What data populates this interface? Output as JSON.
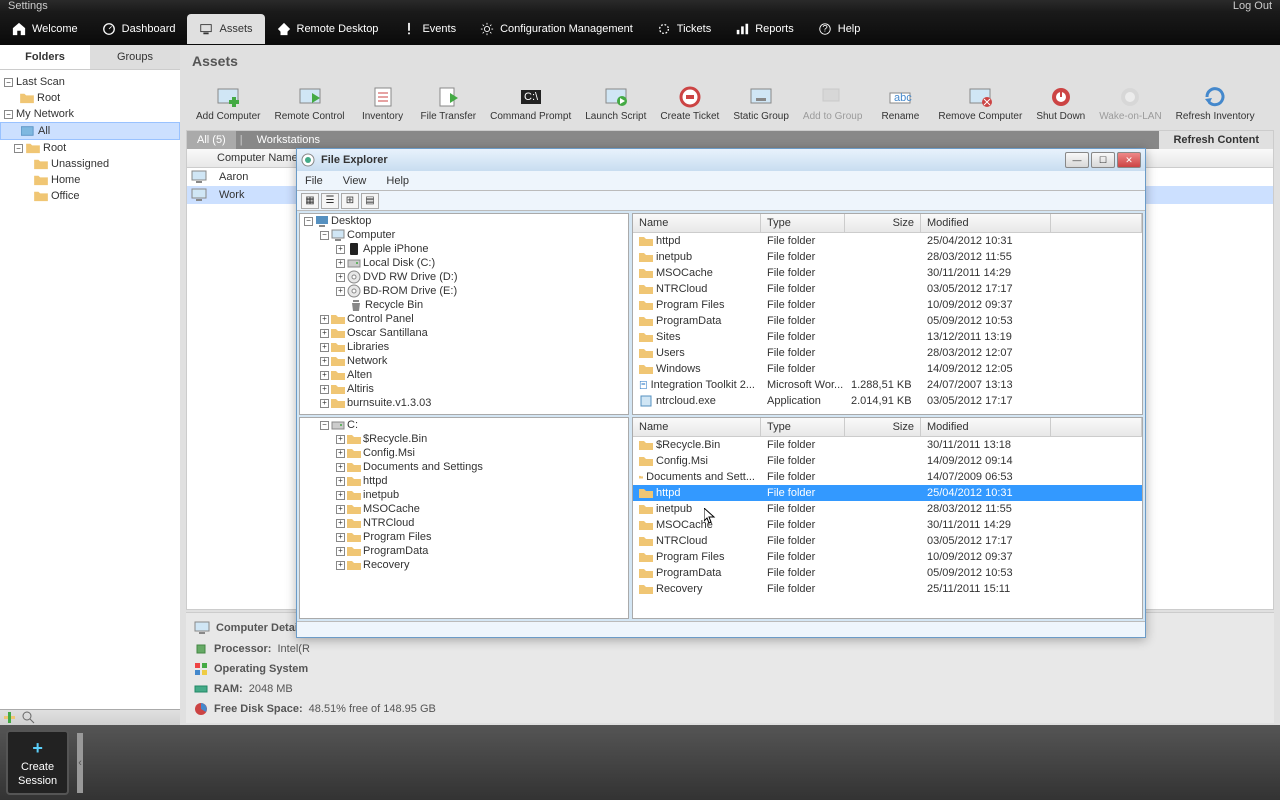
{
  "topbar": {
    "settings": "Settings",
    "logout": "Log Out"
  },
  "nav": {
    "welcome": "Welcome",
    "dashboard": "Dashboard",
    "assets": "Assets",
    "remote": "Remote Desktop",
    "events": "Events",
    "config": "Configuration Management",
    "tickets": "Tickets",
    "reports": "Reports",
    "help": "Help"
  },
  "sidebar": {
    "tabs": {
      "folders": "Folders",
      "groups": "Groups"
    },
    "lastscan": "Last Scan",
    "root": "Root",
    "mynetwork": "My Network",
    "all": "All",
    "root2": "Root",
    "unassigned": "Unassigned",
    "home": "Home",
    "office": "Office"
  },
  "main": {
    "title": "Assets",
    "tools": {
      "addcomputer": "Add Computer",
      "remotecontrol": "Remote Control",
      "inventory": "Inventory",
      "filetransfer": "File Transfer",
      "cmdprompt": "Command Prompt",
      "launchscript": "Launch Script",
      "createticket": "Create Ticket",
      "staticgroup": "Static Group",
      "addtogroup": "Add to Group",
      "rename": "Rename",
      "removecomputer": "Remove Computer",
      "shutdown": "Shut Down",
      "wakeonlan": "Wake-on-LAN",
      "refreshinv": "Refresh Inventory"
    },
    "listTabs": {
      "all": "All (5)",
      "workstations": "Workstations",
      "refresh": "Refresh Content"
    },
    "listHeader": {
      "name": "Computer Name"
    },
    "rows": [
      {
        "name": "Aaron"
      },
      {
        "name": "Work"
      }
    ],
    "details": {
      "title": "Computer Details",
      "processor_lbl": "Processor:",
      "processor_val": "Intel(R",
      "os_lbl": "Operating System",
      "ram_lbl": "RAM:",
      "ram_val": "2048 MB",
      "disk_lbl": "Free Disk Space:",
      "disk_val": "48.51% free of 148.95 GB"
    }
  },
  "session": {
    "create1": "Create",
    "create2": "Session"
  },
  "fe": {
    "title": "File Explorer",
    "menu": {
      "file": "File",
      "view": "View",
      "help": "Help"
    },
    "cols": {
      "name": "Name",
      "type": "Type",
      "size": "Size",
      "mod": "Modified"
    },
    "tree1": [
      {
        "indent": 0,
        "exp": "-",
        "icon": "desktop",
        "label": "Desktop"
      },
      {
        "indent": 1,
        "exp": "-",
        "icon": "computer",
        "label": "Computer"
      },
      {
        "indent": 2,
        "exp": "+",
        "icon": "device",
        "label": "Apple iPhone"
      },
      {
        "indent": 2,
        "exp": "+",
        "icon": "disk",
        "label": "Local Disk (C:)"
      },
      {
        "indent": 2,
        "exp": "+",
        "icon": "disc",
        "label": "DVD RW Drive (D:)"
      },
      {
        "indent": 2,
        "exp": "+",
        "icon": "disc",
        "label": "BD-ROM Drive (E:)"
      },
      {
        "indent": 2,
        "exp": "",
        "icon": "recycle",
        "label": "Recycle Bin"
      },
      {
        "indent": 1,
        "exp": "+",
        "icon": "folder",
        "label": "Control Panel"
      },
      {
        "indent": 1,
        "exp": "+",
        "icon": "folder",
        "label": "Oscar Santillana"
      },
      {
        "indent": 1,
        "exp": "+",
        "icon": "folder",
        "label": "Libraries"
      },
      {
        "indent": 1,
        "exp": "+",
        "icon": "folder",
        "label": "Network"
      },
      {
        "indent": 1,
        "exp": "+",
        "icon": "folder",
        "label": "Alten"
      },
      {
        "indent": 1,
        "exp": "+",
        "icon": "folder",
        "label": "Altiris"
      },
      {
        "indent": 1,
        "exp": "+",
        "icon": "folder",
        "label": "burnsuite.v1.3.03"
      }
    ],
    "files1": [
      {
        "name": "httpd",
        "type": "File folder",
        "size": "",
        "mod": "25/04/2012 10:31",
        "icon": "folder"
      },
      {
        "name": "inetpub",
        "type": "File folder",
        "size": "",
        "mod": "28/03/2012 11:55",
        "icon": "folder"
      },
      {
        "name": "MSOCache",
        "type": "File folder",
        "size": "",
        "mod": "30/11/2011 14:29",
        "icon": "folder"
      },
      {
        "name": "NTRCloud",
        "type": "File folder",
        "size": "",
        "mod": "03/05/2012 17:17",
        "icon": "folder"
      },
      {
        "name": "Program Files",
        "type": "File folder",
        "size": "",
        "mod": "10/09/2012 09:37",
        "icon": "folder"
      },
      {
        "name": "ProgramData",
        "type": "File folder",
        "size": "",
        "mod": "05/09/2012 10:53",
        "icon": "folder"
      },
      {
        "name": "Sites",
        "type": "File folder",
        "size": "",
        "mod": "13/12/2011 13:19",
        "icon": "folder"
      },
      {
        "name": "Users",
        "type": "File folder",
        "size": "",
        "mod": "28/03/2012 12:07",
        "icon": "folder"
      },
      {
        "name": "Windows",
        "type": "File folder",
        "size": "",
        "mod": "14/09/2012 12:05",
        "icon": "folder"
      },
      {
        "name": "Integration Toolkit 2...",
        "type": "Microsoft Wor...",
        "size": "1.288,51 KB",
        "mod": "24/07/2007 13:13",
        "icon": "doc"
      },
      {
        "name": "ntrcloud.exe",
        "type": "Application",
        "size": "2.014,91 KB",
        "mod": "03/05/2012 17:17",
        "icon": "exe"
      }
    ],
    "tree2": [
      {
        "indent": 1,
        "exp": "-",
        "icon": "disk",
        "label": "C:"
      },
      {
        "indent": 2,
        "exp": "+",
        "icon": "folder",
        "label": "$Recycle.Bin"
      },
      {
        "indent": 2,
        "exp": "+",
        "icon": "folder",
        "label": "Config.Msi"
      },
      {
        "indent": 2,
        "exp": "+",
        "icon": "folder",
        "label": "Documents and Settings"
      },
      {
        "indent": 2,
        "exp": "+",
        "icon": "folder",
        "label": "httpd"
      },
      {
        "indent": 2,
        "exp": "+",
        "icon": "folder",
        "label": "inetpub"
      },
      {
        "indent": 2,
        "exp": "+",
        "icon": "folder",
        "label": "MSOCache"
      },
      {
        "indent": 2,
        "exp": "+",
        "icon": "folder",
        "label": "NTRCloud"
      },
      {
        "indent": 2,
        "exp": "+",
        "icon": "folder",
        "label": "Program Files"
      },
      {
        "indent": 2,
        "exp": "+",
        "icon": "folder",
        "label": "ProgramData"
      },
      {
        "indent": 2,
        "exp": "+",
        "icon": "folder",
        "label": "Recovery"
      }
    ],
    "files2": [
      {
        "name": "$Recycle.Bin",
        "type": "File folder",
        "size": "",
        "mod": "30/11/2011 13:18",
        "icon": "folder",
        "sel": false
      },
      {
        "name": "Config.Msi",
        "type": "File folder",
        "size": "",
        "mod": "14/09/2012 09:14",
        "icon": "folder",
        "sel": false
      },
      {
        "name": "Documents and Sett...",
        "type": "File folder",
        "size": "",
        "mod": "14/07/2009 06:53",
        "icon": "folder",
        "sel": false
      },
      {
        "name": "httpd",
        "type": "File folder",
        "size": "",
        "mod": "25/04/2012 10:31",
        "icon": "folder",
        "sel": true
      },
      {
        "name": "inetpub",
        "type": "File folder",
        "size": "",
        "mod": "28/03/2012 11:55",
        "icon": "folder",
        "sel": false
      },
      {
        "name": "MSOCache",
        "type": "File folder",
        "size": "",
        "mod": "30/11/2011 14:29",
        "icon": "folder",
        "sel": false
      },
      {
        "name": "NTRCloud",
        "type": "File folder",
        "size": "",
        "mod": "03/05/2012 17:17",
        "icon": "folder",
        "sel": false
      },
      {
        "name": "Program Files",
        "type": "File folder",
        "size": "",
        "mod": "10/09/2012 09:37",
        "icon": "folder",
        "sel": false
      },
      {
        "name": "ProgramData",
        "type": "File folder",
        "size": "",
        "mod": "05/09/2012 10:53",
        "icon": "folder",
        "sel": false
      },
      {
        "name": "Recovery",
        "type": "File folder",
        "size": "",
        "mod": "25/11/2011 15:11",
        "icon": "folder",
        "sel": false
      }
    ]
  }
}
